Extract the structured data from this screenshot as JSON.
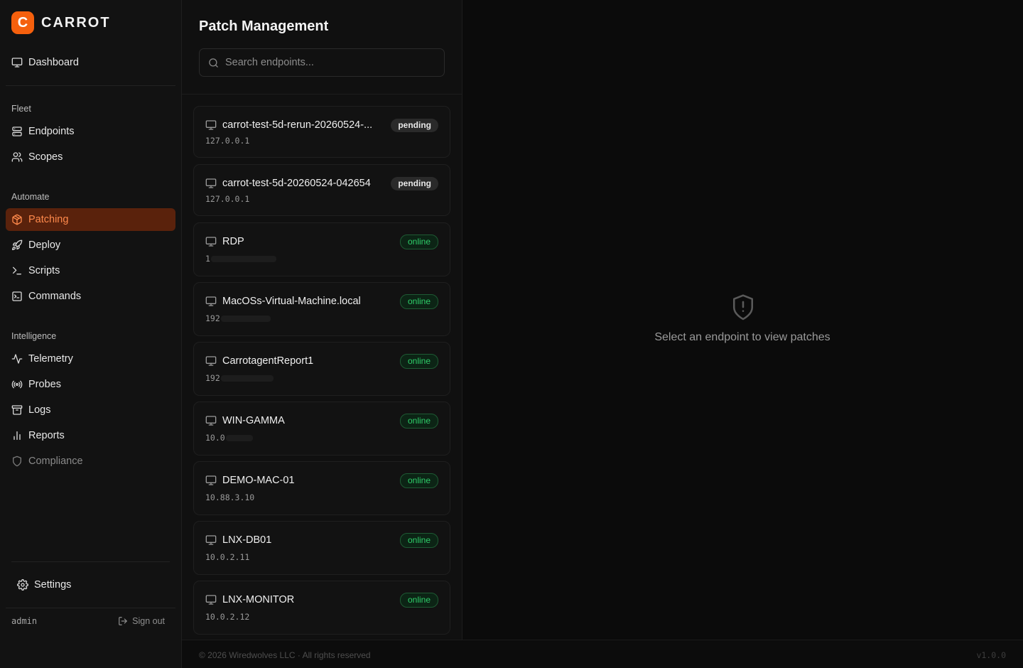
{
  "brand": {
    "logo_letter": "C",
    "name": "CARROT",
    "accent": "#f5600d"
  },
  "sidebar": {
    "top": [
      {
        "label": "Dashboard",
        "icon": "monitor-icon"
      }
    ],
    "sections": [
      {
        "title": "Fleet",
        "items": [
          {
            "label": "Endpoints",
            "icon": "server-icon"
          },
          {
            "label": "Scopes",
            "icon": "users-icon"
          }
        ]
      },
      {
        "title": "Automate",
        "items": [
          {
            "label": "Patching",
            "icon": "package-icon",
            "active": true
          },
          {
            "label": "Deploy",
            "icon": "rocket-icon"
          },
          {
            "label": "Scripts",
            "icon": "terminal-icon"
          },
          {
            "label": "Commands",
            "icon": "command-box-icon"
          }
        ]
      },
      {
        "title": "Intelligence",
        "items": [
          {
            "label": "Telemetry",
            "icon": "activity-icon"
          },
          {
            "label": "Probes",
            "icon": "radio-icon"
          },
          {
            "label": "Logs",
            "icon": "archive-icon"
          },
          {
            "label": "Reports",
            "icon": "bar-chart-icon"
          },
          {
            "label": "Compliance",
            "icon": "shield-icon",
            "dim": true
          }
        ]
      }
    ],
    "settings_label": "Settings",
    "username": "admin",
    "signout_label": "Sign out"
  },
  "list": {
    "title": "Patch Management",
    "search_placeholder": "Search endpoints...",
    "endpoints": [
      {
        "name": "carrot-test-5d-rerun-20260524-...",
        "ip": "127.0.0.1",
        "status": "pending"
      },
      {
        "name": "carrot-test-5d-20260524-042654",
        "ip": "127.0.0.1",
        "status": "pending"
      },
      {
        "name": "RDP",
        "ip": "1",
        "status": "online",
        "ip_redacted": true
      },
      {
        "name": "MacOSs-Virtual-Machine.local",
        "ip": "192",
        "status": "online",
        "ip_redacted": true
      },
      {
        "name": "CarrotagentReport1",
        "ip": "192",
        "status": "online",
        "ip_redacted": true
      },
      {
        "name": "WIN-GAMMA",
        "ip": "10.0",
        "status": "online",
        "ip_redacted": true
      },
      {
        "name": "DEMO-MAC-01",
        "ip": "10.88.3.10",
        "status": "online"
      },
      {
        "name": "LNX-DB01",
        "ip": "10.0.2.11",
        "status": "online"
      },
      {
        "name": "LNX-MONITOR",
        "ip": "10.0.2.12",
        "status": "online"
      }
    ]
  },
  "detail": {
    "empty_text": "Select an endpoint to view patches",
    "empty_icon": "shield-alert-icon"
  },
  "footer": {
    "copyright": "© 2026 Wiredwolves LLC · All rights reserved",
    "version": "v1.0.0"
  }
}
